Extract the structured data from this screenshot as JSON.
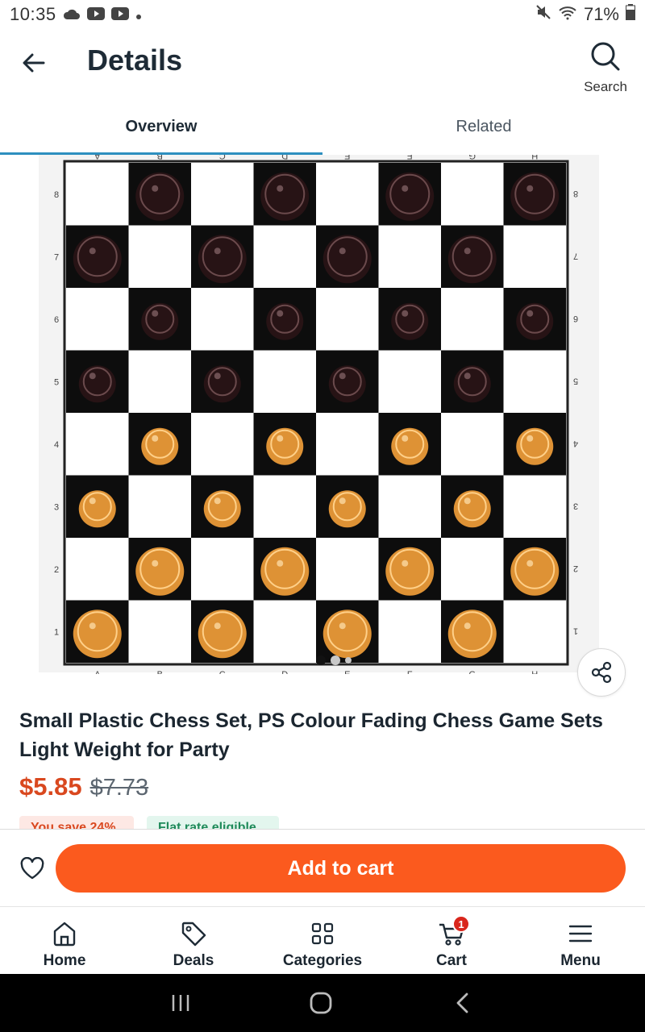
{
  "status_bar": {
    "time": "10:35",
    "battery": "71%"
  },
  "app_bar": {
    "title": "Details",
    "search_label": "Search"
  },
  "tabs": [
    {
      "label": "Overview",
      "active": true
    },
    {
      "label": "Related",
      "active": false
    }
  ],
  "board": {
    "files": [
      "A",
      "B",
      "C",
      "D",
      "E",
      "F",
      "G",
      "H"
    ],
    "ranks": [
      "8",
      "7",
      "6",
      "5",
      "4",
      "3",
      "2",
      "1"
    ],
    "top_ranks": [
      "8",
      "7",
      "6",
      "5",
      "4",
      "3",
      "2",
      "1"
    ]
  },
  "product": {
    "title": "Small Plastic Chess Set, PS Colour Fading Chess Game Sets Light Weight for Party",
    "price": "$5.85",
    "original_price": "$7.73",
    "badges": [
      "You save 24%",
      "Flat rate eligible"
    ]
  },
  "actions": {
    "add_to_cart": "Add to cart"
  },
  "bottom_nav": [
    {
      "label": "Home",
      "icon": "home-icon"
    },
    {
      "label": "Deals",
      "icon": "tag-icon"
    },
    {
      "label": "Categories",
      "icon": "grid-icon"
    },
    {
      "label": "Cart",
      "icon": "cart-icon",
      "badge": "1"
    },
    {
      "label": "Menu",
      "icon": "menu-icon"
    }
  ],
  "colors": {
    "accent": "#fb5a1e",
    "price": "#d9481f",
    "tab_underline": "#2d8fbf",
    "dark_piece": "#2a1416",
    "light_piece": "#f5a13a"
  }
}
